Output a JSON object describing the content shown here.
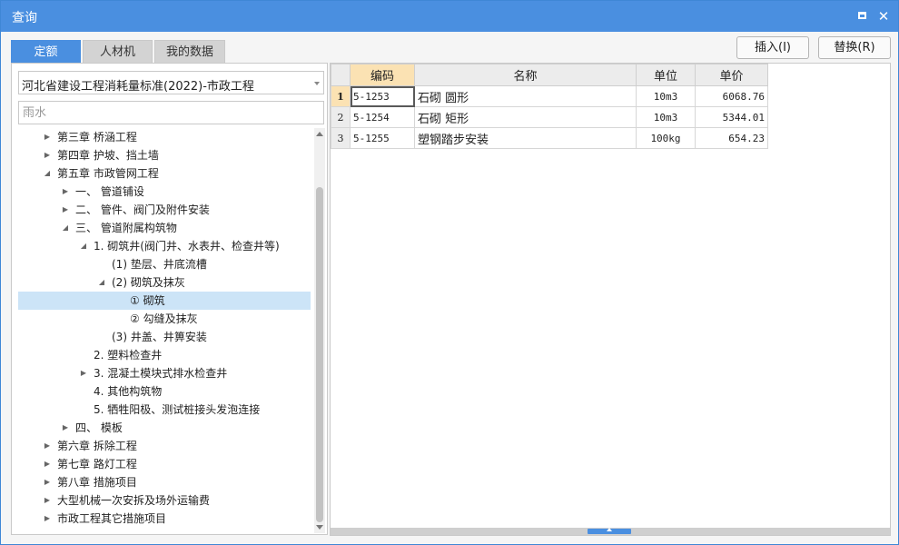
{
  "window": {
    "title": "查询"
  },
  "tabs": [
    {
      "label": "定额",
      "active": true
    },
    {
      "label": "人材机",
      "active": false
    },
    {
      "label": "我的数据",
      "active": false
    }
  ],
  "actions": {
    "insert_label": "插入(I)",
    "replace_label": "替换(R)"
  },
  "library_select": {
    "value": "河北省建设工程消耗量标准(2022)-市政工程"
  },
  "search": {
    "placeholder": "雨水"
  },
  "tree": [
    {
      "label": "第三章 桥涵工程",
      "level": 0,
      "toggle": "collapsed"
    },
    {
      "label": "第四章 护坡、挡土墙",
      "level": 0,
      "toggle": "collapsed"
    },
    {
      "label": "第五章 市政管网工程",
      "level": 0,
      "toggle": "expanded"
    },
    {
      "label": "一、 管道铺设",
      "level": 1,
      "toggle": "collapsed"
    },
    {
      "label": "二、 管件、阀门及附件安装",
      "level": 1,
      "toggle": "collapsed"
    },
    {
      "label": "三、 管道附属构筑物",
      "level": 1,
      "toggle": "expanded"
    },
    {
      "label": "1. 砌筑井(阀门井、水表井、检查井等)",
      "level": 2,
      "toggle": "expanded"
    },
    {
      "label": "(1) 垫层、井底流槽",
      "level": 3,
      "toggle": "none"
    },
    {
      "label": "(2) 砌筑及抹灰",
      "level": 3,
      "toggle": "expanded"
    },
    {
      "label": "① 砌筑",
      "level": 4,
      "toggle": "none",
      "selected": true
    },
    {
      "label": "② 勾缝及抹灰",
      "level": 4,
      "toggle": "none"
    },
    {
      "label": "(3) 井盖、井箅安装",
      "level": 3,
      "toggle": "none"
    },
    {
      "label": "2. 塑料检查井",
      "level": 2,
      "toggle": "none"
    },
    {
      "label": "3. 混凝土模块式排水检查井",
      "level": 2,
      "toggle": "collapsed"
    },
    {
      "label": "4. 其他构筑物",
      "level": 2,
      "toggle": "none"
    },
    {
      "label": "5. 牺牲阳极、测试桩接头发泡连接",
      "level": 2,
      "toggle": "none"
    },
    {
      "label": "四、 模板",
      "level": 1,
      "toggle": "collapsed"
    },
    {
      "label": "第六章 拆除工程",
      "level": 0,
      "toggle": "collapsed"
    },
    {
      "label": "第七章 路灯工程",
      "level": 0,
      "toggle": "collapsed"
    },
    {
      "label": "第八章 措施项目",
      "level": 0,
      "toggle": "collapsed"
    },
    {
      "label": "大型机械一次安拆及场外运输费",
      "level": 0,
      "toggle": "collapsed"
    },
    {
      "label": "市政工程其它措施项目",
      "level": 0,
      "toggle": "collapsed"
    }
  ],
  "grid": {
    "columns": [
      "编码",
      "名称",
      "单位",
      "单价"
    ],
    "rows": [
      {
        "num": "1",
        "code": "5-1253",
        "name": "石砌 圆形",
        "unit": "10m3",
        "price": "6068.76"
      },
      {
        "num": "2",
        "code": "5-1254",
        "name": "石砌 矩形",
        "unit": "10m3",
        "price": "5344.01"
      },
      {
        "num": "3",
        "code": "5-1255",
        "name": "塑钢踏步安装",
        "unit": "100kg",
        "price": "654.23"
      }
    ]
  },
  "colors": {
    "accent": "#4a8fe0",
    "selection": "#cce4f7",
    "header_highlight": "#fbe2b3"
  }
}
